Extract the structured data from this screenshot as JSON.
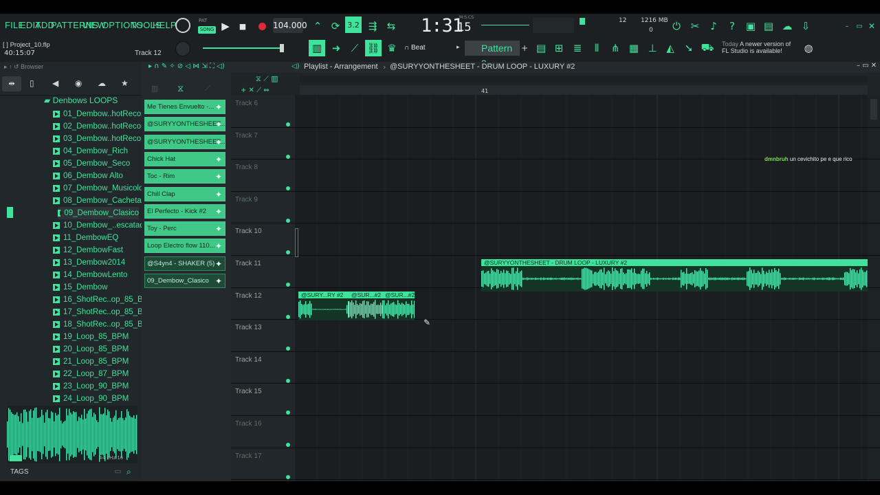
{
  "menu": [
    "FILE",
    "EDIT",
    "ADD",
    "PATTERNS",
    "VIEW",
    "OPTIONS",
    "TOOLS",
    "HELP"
  ],
  "transport": {
    "pat_label": "PAT",
    "song_label": "SONG",
    "tempo": "104.000",
    "time": "1:31",
    "time_sub": "15",
    "time_unit": "M:S:CS"
  },
  "cpu": {
    "voices": "12",
    "memory": "1216 MB",
    "cpu_small": "0"
  },
  "project": {
    "file": "Project_10.flp",
    "time": "40:15:07",
    "hint": "Track 12",
    "bracket": "[ ]"
  },
  "snap": {
    "label": "Beat"
  },
  "pattern": {
    "label": "Pattern 3"
  },
  "news": {
    "line1_a": "Today",
    "line1_b": "A newer version of",
    "line2": "FL Studio is available!"
  },
  "browser": {
    "title": "Browser",
    "folder": "Denbows LOOPS",
    "items": [
      "01_Dembow..hotRecords",
      "02_Dembow..hotRecords",
      "03_Dembow..hotRecords",
      "04_Dembow_Rich",
      "05_Dembow_Seco",
      "06_Dembow Alto",
      "07_Dembow_Musicologo",
      "08_Dembow_Cachetada",
      "09_Dembow_Clasico",
      "10_Dembow_..escatador",
      "11_DembowEQ",
      "12_DembowFast",
      "13_Dembow2014",
      "14_DembowLento",
      "15_Dembow",
      "16_ShotRec..op_85_BPM",
      "17_ShotRec..op_85_BPM",
      "18_ShotRec..op_85_BPM",
      "19_Loop_85_BPM",
      "20_Loop_85_BPM",
      "21_Loop_85_BPM",
      "22_Loop_87_BPM",
      "23_Loop_90_BPM",
      "24_Loop_90_BPM"
    ],
    "selected_index": 8,
    "tags_label": "TAGS",
    "preview_info": "44 kHz 16"
  },
  "channels": [
    "Me Tienes Envuelto -...",
    "@SURYYONTHESHEET...",
    "@SURYYONTHESHEET...",
    "Chick Hat",
    "Toc - Rim",
    "Chill Clap",
    "El Perfecto - Kick #2",
    "Toy - Perc",
    "Loop Electro flow 110...",
    "@S4yn4 - SHAKER (5)",
    "09_Dembow_Clasico"
  ],
  "playlist": {
    "title": "Playlist - Arrangement",
    "crumb": "@SURYYONTHESHEET - DRUM LOOP - LUXURY #2",
    "bar_marker": "41",
    "tracks": [
      "Track 6",
      "Track 7",
      "Track 8",
      "Track 9",
      "Track 10",
      "Track 11",
      "Track 12",
      "Track 13",
      "Track 14",
      "Track 15",
      "Track 16",
      "Track 17"
    ],
    "clip_a": "@SURYYONTHESHEET - DRUM LOOP - LUXURY #2",
    "clip_b1": "@SURY...RY #2",
    "clip_b2": "@SUR...#2",
    "clip_b3": "@SUR...#2",
    "chat_user": "dmnbruh",
    "chat_msg": "un cevichito pe e que rico"
  },
  "colors": {
    "accent": "#3fe39b",
    "bg": "#1a1e21",
    "panel": "#22272b"
  }
}
